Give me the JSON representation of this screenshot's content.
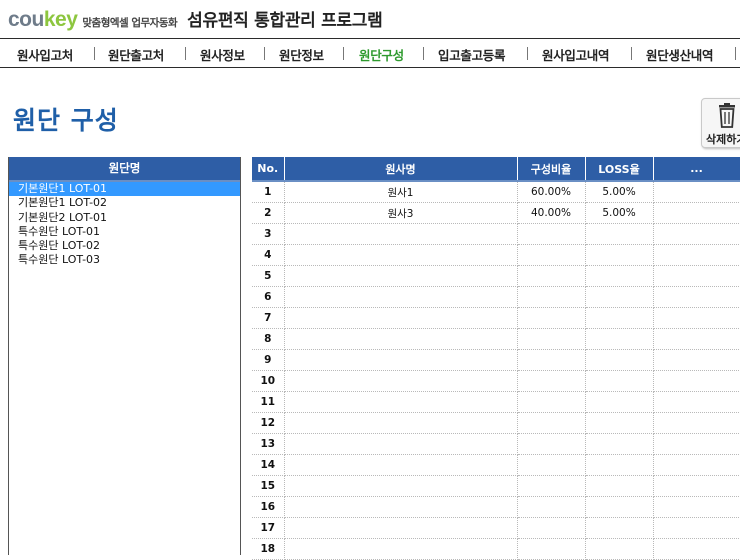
{
  "header": {
    "logo_a": "cou",
    "logo_b": "key",
    "tagline": "맞춤형엑셀 업무자동화",
    "app_title": "섬유편직 통합관리 프로그램"
  },
  "nav": {
    "items": [
      {
        "label": "원사입고처",
        "active": false
      },
      {
        "label": "원단출고처",
        "active": false
      },
      {
        "label": "원사정보",
        "active": false
      },
      {
        "label": "원단정보",
        "active": false
      },
      {
        "label": "원단구성",
        "active": true
      },
      {
        "label": "입고출고등록",
        "active": false
      },
      {
        "label": "원사입고내역",
        "active": false
      },
      {
        "label": "원단생산내역",
        "active": false
      }
    ]
  },
  "page": {
    "title": "원단 구성",
    "delete_label": "삭제하기",
    "delete_icon": "trash-icon"
  },
  "fabric_list": {
    "header": "원단명",
    "items": [
      {
        "label": "기본원단1 LOT-01",
        "selected": true
      },
      {
        "label": "기본원단1 LOT-02",
        "selected": false
      },
      {
        "label": "기본원단2 LOT-01",
        "selected": false
      },
      {
        "label": "특수원단 LOT-01",
        "selected": false
      },
      {
        "label": "특수원단 LOT-02",
        "selected": false
      },
      {
        "label": "특수원단 LOT-03",
        "selected": false
      }
    ]
  },
  "composition_table": {
    "columns": [
      "No.",
      "원사명",
      "구성비율",
      "LOSS율",
      "..."
    ],
    "rows": [
      {
        "no": "1",
        "yarn": "원사1",
        "ratio": "60.00%",
        "loss": "5.00%"
      },
      {
        "no": "2",
        "yarn": "원사3",
        "ratio": "40.00%",
        "loss": "5.00%"
      },
      {
        "no": "3",
        "yarn": "",
        "ratio": "",
        "loss": ""
      },
      {
        "no": "4",
        "yarn": "",
        "ratio": "",
        "loss": ""
      },
      {
        "no": "5",
        "yarn": "",
        "ratio": "",
        "loss": ""
      },
      {
        "no": "6",
        "yarn": "",
        "ratio": "",
        "loss": ""
      },
      {
        "no": "7",
        "yarn": "",
        "ratio": "",
        "loss": ""
      },
      {
        "no": "8",
        "yarn": "",
        "ratio": "",
        "loss": ""
      },
      {
        "no": "9",
        "yarn": "",
        "ratio": "",
        "loss": ""
      },
      {
        "no": "10",
        "yarn": "",
        "ratio": "",
        "loss": ""
      },
      {
        "no": "11",
        "yarn": "",
        "ratio": "",
        "loss": ""
      },
      {
        "no": "12",
        "yarn": "",
        "ratio": "",
        "loss": ""
      },
      {
        "no": "13",
        "yarn": "",
        "ratio": "",
        "loss": ""
      },
      {
        "no": "14",
        "yarn": "",
        "ratio": "",
        "loss": ""
      },
      {
        "no": "15",
        "yarn": "",
        "ratio": "",
        "loss": ""
      },
      {
        "no": "16",
        "yarn": "",
        "ratio": "",
        "loss": ""
      },
      {
        "no": "17",
        "yarn": "",
        "ratio": "",
        "loss": ""
      },
      {
        "no": "18",
        "yarn": "",
        "ratio": "",
        "loss": ""
      }
    ]
  },
  "colors": {
    "header_blue": "#2e5ea6",
    "title_blue": "#1f5fa8",
    "active_green": "#2e9a2e",
    "selection_blue": "#3399ff"
  }
}
